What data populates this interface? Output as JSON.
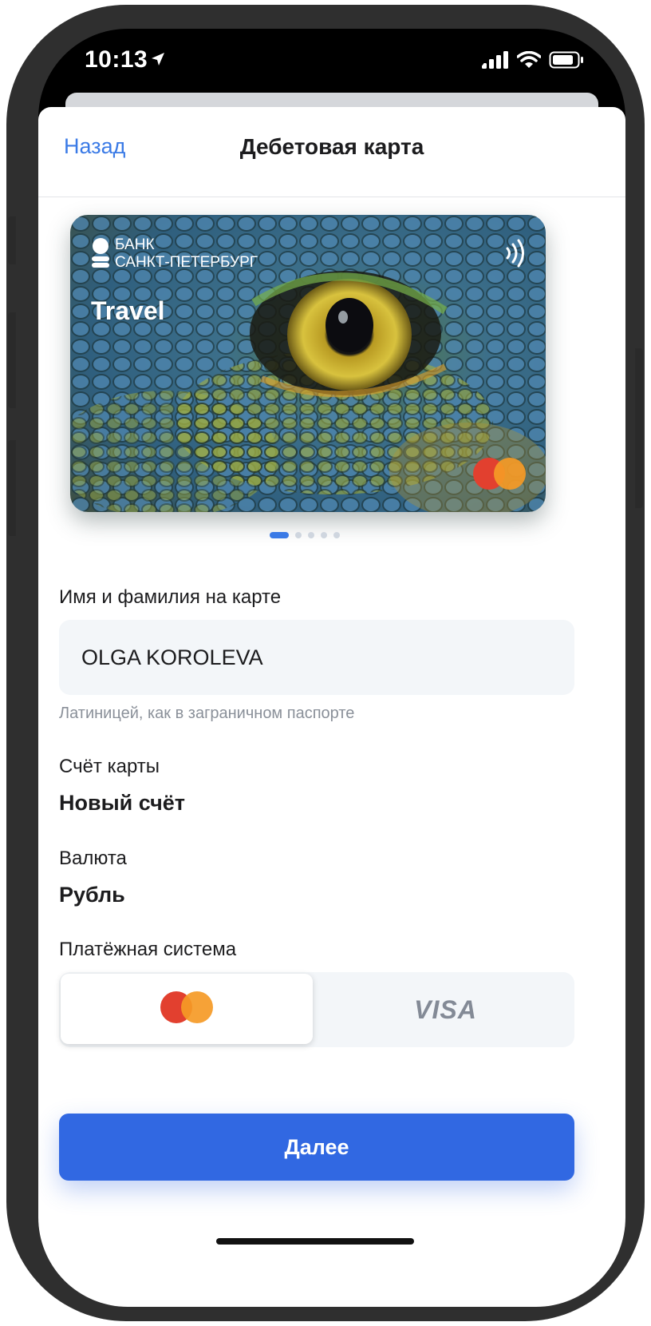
{
  "status_bar": {
    "time": "10:13"
  },
  "nav": {
    "back_label": "Назад",
    "title": "Дебетовая карта"
  },
  "card": {
    "bank_name_line1": "БАНК",
    "bank_name_line2": "САНКТ-ПЕТЕРБУРГ",
    "title": "Travel",
    "carousel_pages": 5,
    "carousel_active": 1
  },
  "form": {
    "name_label": "Имя и фамилия на карте",
    "name_value": "OLGA KOROLEVA",
    "name_hint": "Латиницей, как в заграничном паспорте",
    "account_label": "Счёт карты",
    "account_value": "Новый счёт",
    "currency_label": "Валюта",
    "currency_value": "Рубль",
    "payment_label": "Платёжная система",
    "payment_options": [
      "Mastercard",
      "VISA"
    ],
    "payment_selected": "Mastercard",
    "visa_text": "VISA"
  },
  "cta": {
    "next_label": "Далее"
  },
  "colors": {
    "accent": "#3168e2",
    "link": "#3a7ae6",
    "mc_red": "#e2402f",
    "mc_orange": "#f59a26"
  }
}
